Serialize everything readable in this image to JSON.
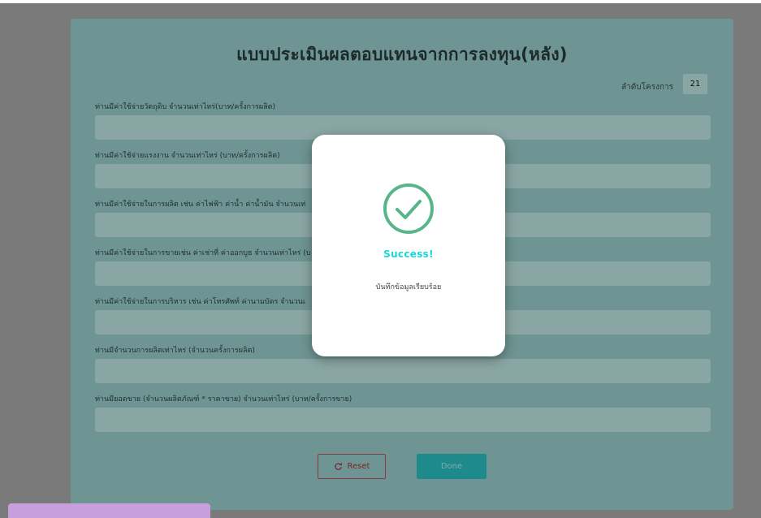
{
  "form": {
    "title": "แบบประเมินผลตอบแทนจากการลงทุน(หลัง)",
    "sequence_label": "ลำดับโครงการ",
    "sequence_value": "21",
    "fields": [
      {
        "label": "ท่านมีค่าใช้จ่ายวัตถุดิบ จำนวนเท่าไหร่(บาท/ครั้งการผลิต)",
        "value": ""
      },
      {
        "label": "ท่านมีค่าใช้จ่ายแรงงาน จำนวนเท่าไหร่ (บาท/ครั้งการผลิต)",
        "value": ""
      },
      {
        "label": "ท่านมีค่าใช้จ่ายในการผลิต เช่น ค่าไฟฟ้า ค่าน้ำ ค่าน้ำมัน จำนวนเท่",
        "value": ""
      },
      {
        "label": "ท่านมีค่าใช้จ่ายในการขายเช่น ค่าเช่าที่ ค่าออกบูธ จำนวนเท่าไหร่ (บ",
        "value": ""
      },
      {
        "label": "ท่านมีค่าใช้จ่ายในการบริหาร เช่น ค่าโทรศัพท์ ค่านามบัตร จำนวนเ",
        "value": ""
      },
      {
        "label": "ท่านมีจำนวนการผลิตเท่าไหร่ (จำนวนครั้งการผลิต)",
        "value": ""
      },
      {
        "label": "ท่านมียอดขาย (จำนวนผลิตภัณฑ์ * ราคาขาย) จำนวนเท่าไหร่ (บาท/ครั้งการขาย)",
        "value": ""
      }
    ],
    "reset_label": "Reset",
    "done_label": "Done"
  },
  "modal": {
    "title": "Success!",
    "message": "บันทึกข้อมูลเรียบร้อย",
    "icon": "check-circle-icon",
    "accent": "#17d9d9",
    "icon_color": "#58b58a"
  },
  "colors": {
    "overlay": "#7a7a7a",
    "card": "#6e9593",
    "input": "#8aa6a4",
    "done_button": "#1f8a8c",
    "reset_border": "#8a3a3a",
    "bottom_bar": "#c79fdc"
  }
}
